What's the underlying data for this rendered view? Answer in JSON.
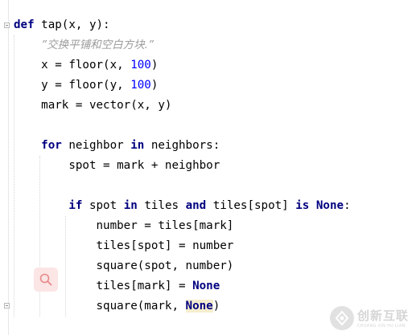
{
  "editor": {
    "lines": [
      {
        "indent": 0,
        "tokens": [
          {
            "t": "def",
            "c": "kw"
          },
          {
            "t": " tap(x, y):",
            "c": ""
          }
        ]
      },
      {
        "indent": 1,
        "tokens": [
          {
            "t": "”交换平铺和空白方块.”",
            "c": "doc"
          }
        ]
      },
      {
        "indent": 1,
        "tokens": [
          {
            "t": "x = floor(x, ",
            "c": ""
          },
          {
            "t": "100",
            "c": "num"
          },
          {
            "t": ")",
            "c": ""
          }
        ]
      },
      {
        "indent": 1,
        "tokens": [
          {
            "t": "y = floor(y, ",
            "c": ""
          },
          {
            "t": "100",
            "c": "num"
          },
          {
            "t": ")",
            "c": ""
          }
        ]
      },
      {
        "indent": 1,
        "tokens": [
          {
            "t": "mark = vector(x, y)",
            "c": ""
          }
        ]
      },
      {
        "indent": 0,
        "tokens": []
      },
      {
        "indent": 1,
        "tokens": [
          {
            "t": "for",
            "c": "kw"
          },
          {
            "t": " neighbor ",
            "c": ""
          },
          {
            "t": "in",
            "c": "kw"
          },
          {
            "t": " neighbors:",
            "c": ""
          }
        ]
      },
      {
        "indent": 2,
        "tokens": [
          {
            "t": "spot = mark + neighbor",
            "c": ""
          }
        ]
      },
      {
        "indent": 0,
        "tokens": []
      },
      {
        "indent": 2,
        "tokens": [
          {
            "t": "if",
            "c": "kw"
          },
          {
            "t": " spot ",
            "c": ""
          },
          {
            "t": "in",
            "c": "kw"
          },
          {
            "t": " tiles ",
            "c": ""
          },
          {
            "t": "and",
            "c": "kw"
          },
          {
            "t": " tiles[spot] ",
            "c": ""
          },
          {
            "t": "is",
            "c": "kw"
          },
          {
            "t": " ",
            "c": ""
          },
          {
            "t": "None",
            "c": "kw"
          },
          {
            "t": ":",
            "c": ""
          }
        ]
      },
      {
        "indent": 3,
        "tokens": [
          {
            "t": "number = tiles[mark]",
            "c": ""
          }
        ]
      },
      {
        "indent": 3,
        "tokens": [
          {
            "t": "tiles[spot] = number",
            "c": ""
          }
        ]
      },
      {
        "indent": 3,
        "tokens": [
          {
            "t": "square(spot, number)",
            "c": ""
          }
        ]
      },
      {
        "indent": 3,
        "tokens": [
          {
            "t": "tiles[mark] = ",
            "c": ""
          },
          {
            "t": "None",
            "c": "kw"
          }
        ]
      },
      {
        "indent": 3,
        "tokens": [
          {
            "t": "square(mark, ",
            "c": ""
          },
          {
            "t": "None",
            "c": "kw hl"
          },
          {
            "t": ")",
            "c": ""
          }
        ]
      }
    ]
  },
  "search_button": {
    "icon": "search-icon",
    "color": "#e35d5d"
  },
  "watermark": {
    "cn": "创新互联",
    "en": "CHUANG XIN HU LIAN"
  },
  "colors": {
    "keyword": "#000080",
    "number": "#0000ff",
    "docstring": "#9c9c9c"
  }
}
